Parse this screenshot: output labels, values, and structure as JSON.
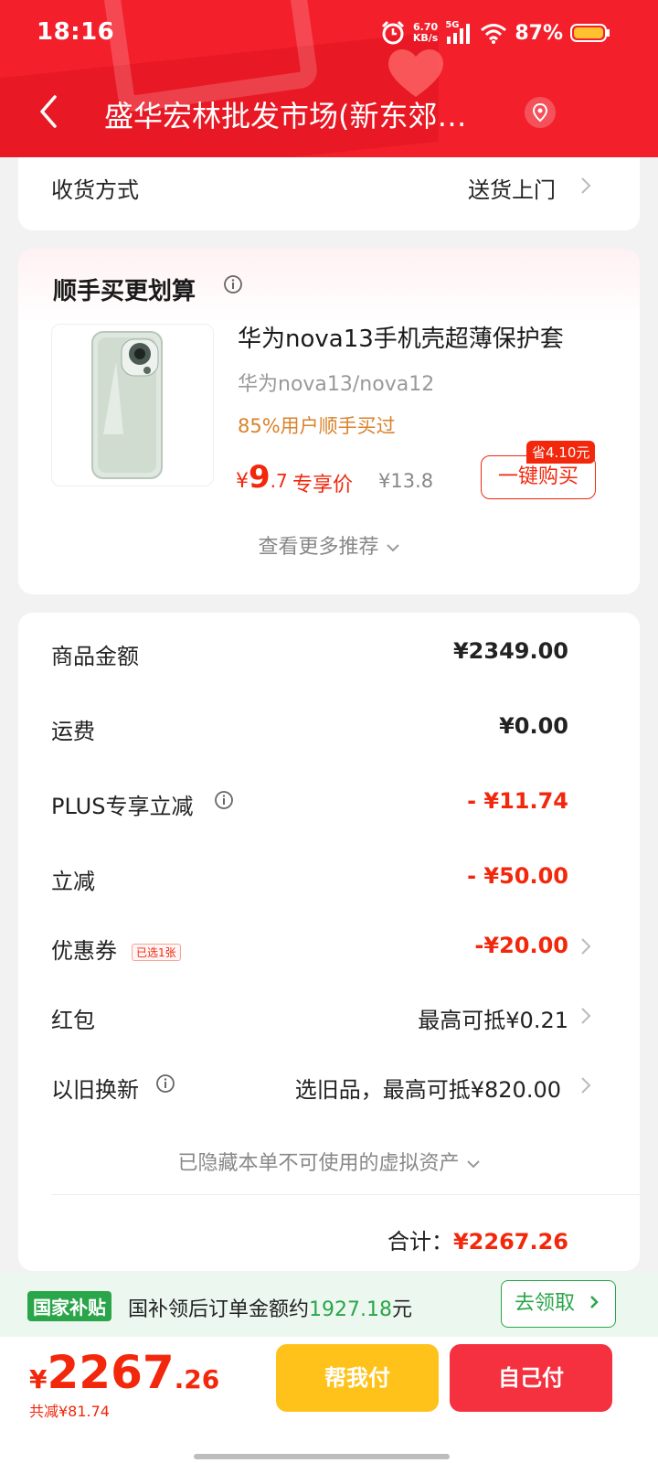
{
  "status_bar": {
    "time": "18:16",
    "net_speed_value": "6.70",
    "net_speed_unit": "KB/s",
    "network": "5G",
    "battery": "87%"
  },
  "header": {
    "title": "盛华宏林批发市场(新东郊…"
  },
  "delivery": {
    "label": "收货方式",
    "value": "送货上门"
  },
  "addon": {
    "title": "顺手买更划算",
    "product": {
      "name": "华为nova13手机壳超薄保护套",
      "model": "华为nova13/nova12",
      "hint": "85%用户顺手买过",
      "price_symbol": "¥",
      "price_int": "9",
      "price_dec": ".7",
      "price_tag": "专享价",
      "original_price": "¥13.8",
      "save_badge": "省4.10元",
      "buy_label": "一键购买"
    },
    "more": "查看更多推荐"
  },
  "fees": {
    "goods_label": "商品金额",
    "goods_value": "¥2349.00",
    "shipping_label": "运费",
    "shipping_value": "¥0.00",
    "plus_label": "PLUS专享立减",
    "plus_value": "- ¥11.74",
    "discount_label": "立减",
    "discount_value": "- ¥50.00",
    "coupon_label": "优惠券",
    "coupon_badge": "已选1张",
    "coupon_value": "-¥20.00",
    "redpacket_label": "红包",
    "redpacket_value": "最高可抵¥0.21",
    "tradein_label": "以旧换新",
    "tradein_value": "选旧品，最高可抵¥820.00",
    "hidden_assets": "已隐藏本单不可使用的虚拟资产",
    "total_label": "合计：",
    "total_value": "¥2267.26"
  },
  "subsidy": {
    "badge": "国家补贴",
    "text": "国补领后订单金额约",
    "amount": "1927.18",
    "unit": "元",
    "button": "去领取"
  },
  "bottom": {
    "price_symbol": "¥",
    "price_int": "2267",
    "price_dec": ".26",
    "saved": "共减¥81.74",
    "help_pay": "帮我付",
    "self_pay": "自己付"
  },
  "colors": {
    "header_red": "#f3202c",
    "price_red": "#f2270c",
    "subsidy_green": "#2aa54a",
    "help_yellow": "#ffc21a",
    "self_red": "#f5303f"
  }
}
